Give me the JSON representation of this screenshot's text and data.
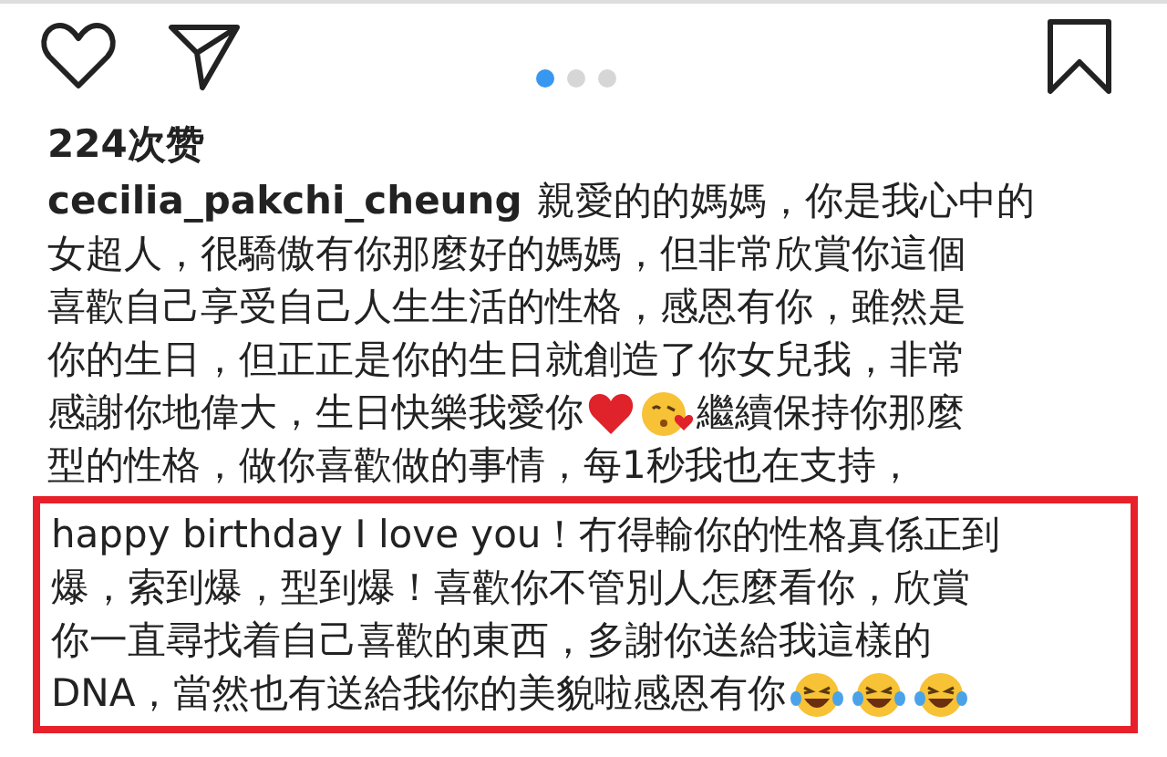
{
  "pager": {
    "dots": [
      {
        "selected": true
      },
      {
        "selected": false
      },
      {
        "selected": false
      }
    ]
  },
  "likes": "224次赞",
  "caption": {
    "lines": [
      [
        {
          "kind": "username",
          "text": "cecilia_pakchi_cheung"
        },
        {
          "kind": "text",
          "text": "親愛的的媽媽，你是我心中的"
        }
      ],
      [
        {
          "kind": "text",
          "text": "女超人，很驕傲有你那麼好的媽媽，但非常欣賞你這個"
        }
      ],
      [
        {
          "kind": "text",
          "text": "喜歡自己享受自己人生生活的性格，感恩有你，雖然是"
        }
      ],
      [
        {
          "kind": "text",
          "text": "你的生日，但正正是你的生日就創造了你女兒我，非常"
        }
      ],
      [
        {
          "kind": "text",
          "text": "感謝你地偉大，生日快樂我愛你"
        },
        {
          "kind": "heart"
        },
        {
          "kind": "kiss"
        },
        {
          "kind": "text",
          "text": "繼續保持你那麼"
        }
      ],
      [
        {
          "kind": "text",
          "text": "型的性格，做你喜歡做的事情，每1秒我也在支持，"
        }
      ]
    ]
  },
  "highlight": {
    "lines": [
      [
        {
          "kind": "text",
          "text": "happy birthday I love you！冇得輸你的性格真係正到"
        }
      ],
      [
        {
          "kind": "text",
          "text": "爆，索到爆，型到爆！喜歡你不管別人怎麼看你，欣賞"
        }
      ],
      [
        {
          "kind": "text",
          "text": "你一直尋找着自己喜歡的東西，多謝你送給我這樣的"
        }
      ],
      [
        {
          "kind": "text",
          "text": "DNA，當然也有送給我你的美貌啦感恩有你"
        },
        {
          "kind": "laugh"
        },
        {
          "kind": "laugh"
        },
        {
          "kind": "laugh"
        }
      ]
    ]
  }
}
